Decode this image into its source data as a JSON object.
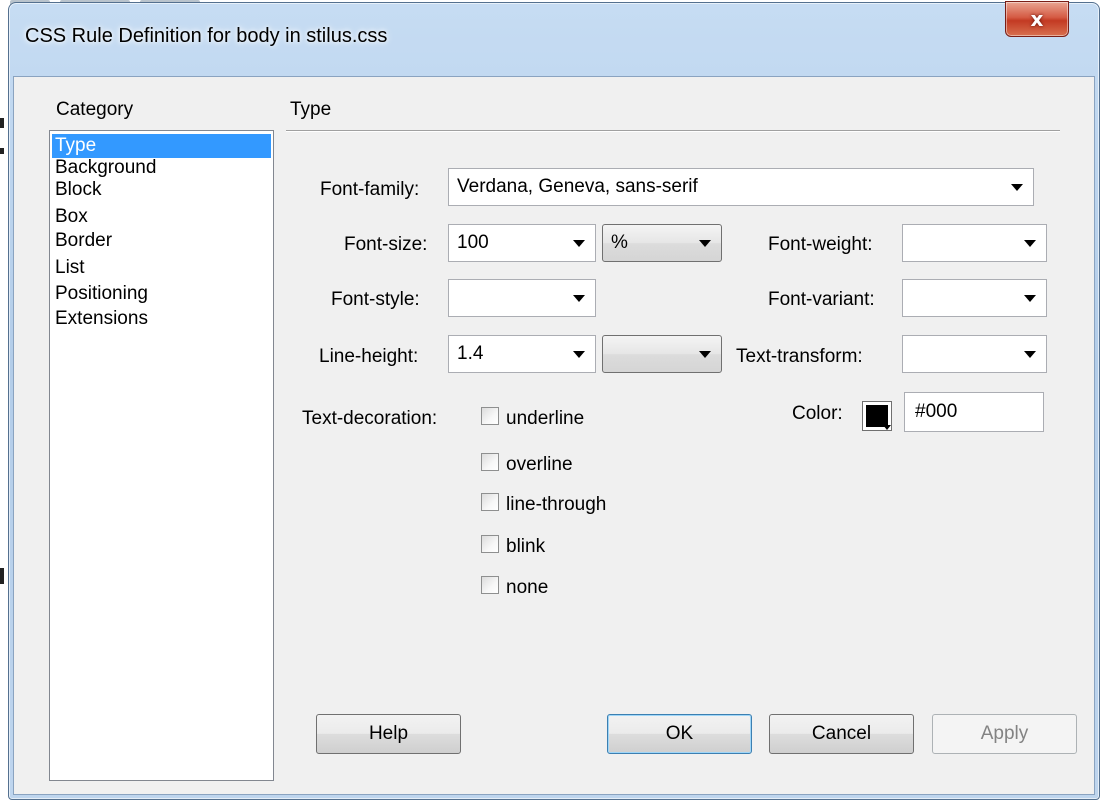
{
  "window": {
    "title": "CSS Rule Definition for body in stilus.css",
    "close_glyph": "x"
  },
  "category": {
    "label": "Category",
    "items": [
      {
        "label": "Type",
        "selected": true
      },
      {
        "label": "Background"
      },
      {
        "label": "Block"
      },
      {
        "label": "Box"
      },
      {
        "label": "Border"
      },
      {
        "label": "List"
      },
      {
        "label": "Positioning"
      },
      {
        "label": "Extensions"
      }
    ]
  },
  "panel": {
    "heading": "Type",
    "font_family": {
      "label": "Font-family:",
      "value": "Verdana, Geneva, sans-serif"
    },
    "font_size": {
      "label": "Font-size:",
      "value": "100",
      "unit": "%"
    },
    "font_weight": {
      "label": "Font-weight:",
      "value": ""
    },
    "font_style": {
      "label": "Font-style:",
      "value": ""
    },
    "font_variant": {
      "label": "Font-variant:",
      "value": ""
    },
    "line_height": {
      "label": "Line-height:",
      "value": "1.4",
      "unit": ""
    },
    "text_transform": {
      "label": "Text-transform:",
      "value": ""
    },
    "text_decoration": {
      "label": "Text-decoration:",
      "options": [
        {
          "label": "underline",
          "checked": false
        },
        {
          "label": "overline",
          "checked": false
        },
        {
          "label": "line-through",
          "checked": false
        },
        {
          "label": "blink",
          "checked": false
        },
        {
          "label": "none",
          "checked": false
        }
      ]
    },
    "color": {
      "label": "Color:",
      "value": "#000",
      "swatch": "#000000"
    }
  },
  "buttons": {
    "help": "Help",
    "ok": "OK",
    "cancel": "Cancel",
    "apply": "Apply"
  }
}
